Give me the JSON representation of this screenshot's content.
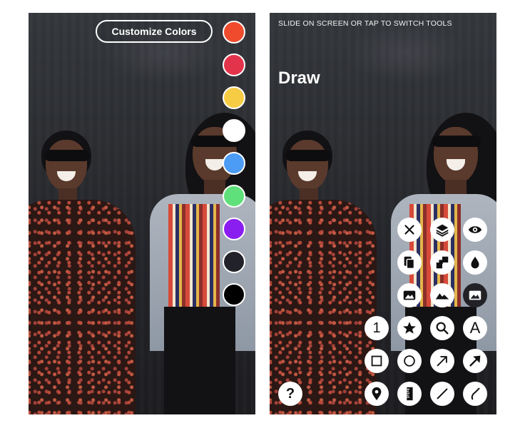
{
  "left_screen": {
    "customize_button_label": "Customize Colors",
    "color_swatches": [
      {
        "name": "orange-red",
        "color": "#f04b2d"
      },
      {
        "name": "red",
        "color": "#e3334a"
      },
      {
        "name": "yellow",
        "color": "#f7cc45"
      },
      {
        "name": "white",
        "color": "#ffffff"
      },
      {
        "name": "blue",
        "color": "#4c9bf4"
      },
      {
        "name": "green",
        "color": "#5fe07a"
      },
      {
        "name": "purple",
        "color": "#8a1df0"
      },
      {
        "name": "dark-gray",
        "color": "#22232a"
      },
      {
        "name": "black",
        "color": "#000000"
      }
    ]
  },
  "right_screen": {
    "hint_text": "SLIDE ON SCREEN OR TAP TO SWITCH TOOLS",
    "mode_title": "Draw",
    "tools": {
      "number_label": "1",
      "text_label": "A",
      "help_label": "?"
    },
    "tool_icons": [
      "close-icon",
      "layers-icon",
      "eye-icon",
      "copy-icon",
      "mosaic-icon",
      "drop-icon",
      "image-icon",
      "landscape-icon",
      "image-dark-icon",
      "number-icon",
      "star-icon",
      "search-icon",
      "text-icon",
      "square-icon",
      "circle-icon",
      "arrow-icon",
      "arrow-filled-icon",
      "help-icon",
      "pin-icon",
      "ruler-icon",
      "line-icon",
      "pen-icon"
    ]
  }
}
